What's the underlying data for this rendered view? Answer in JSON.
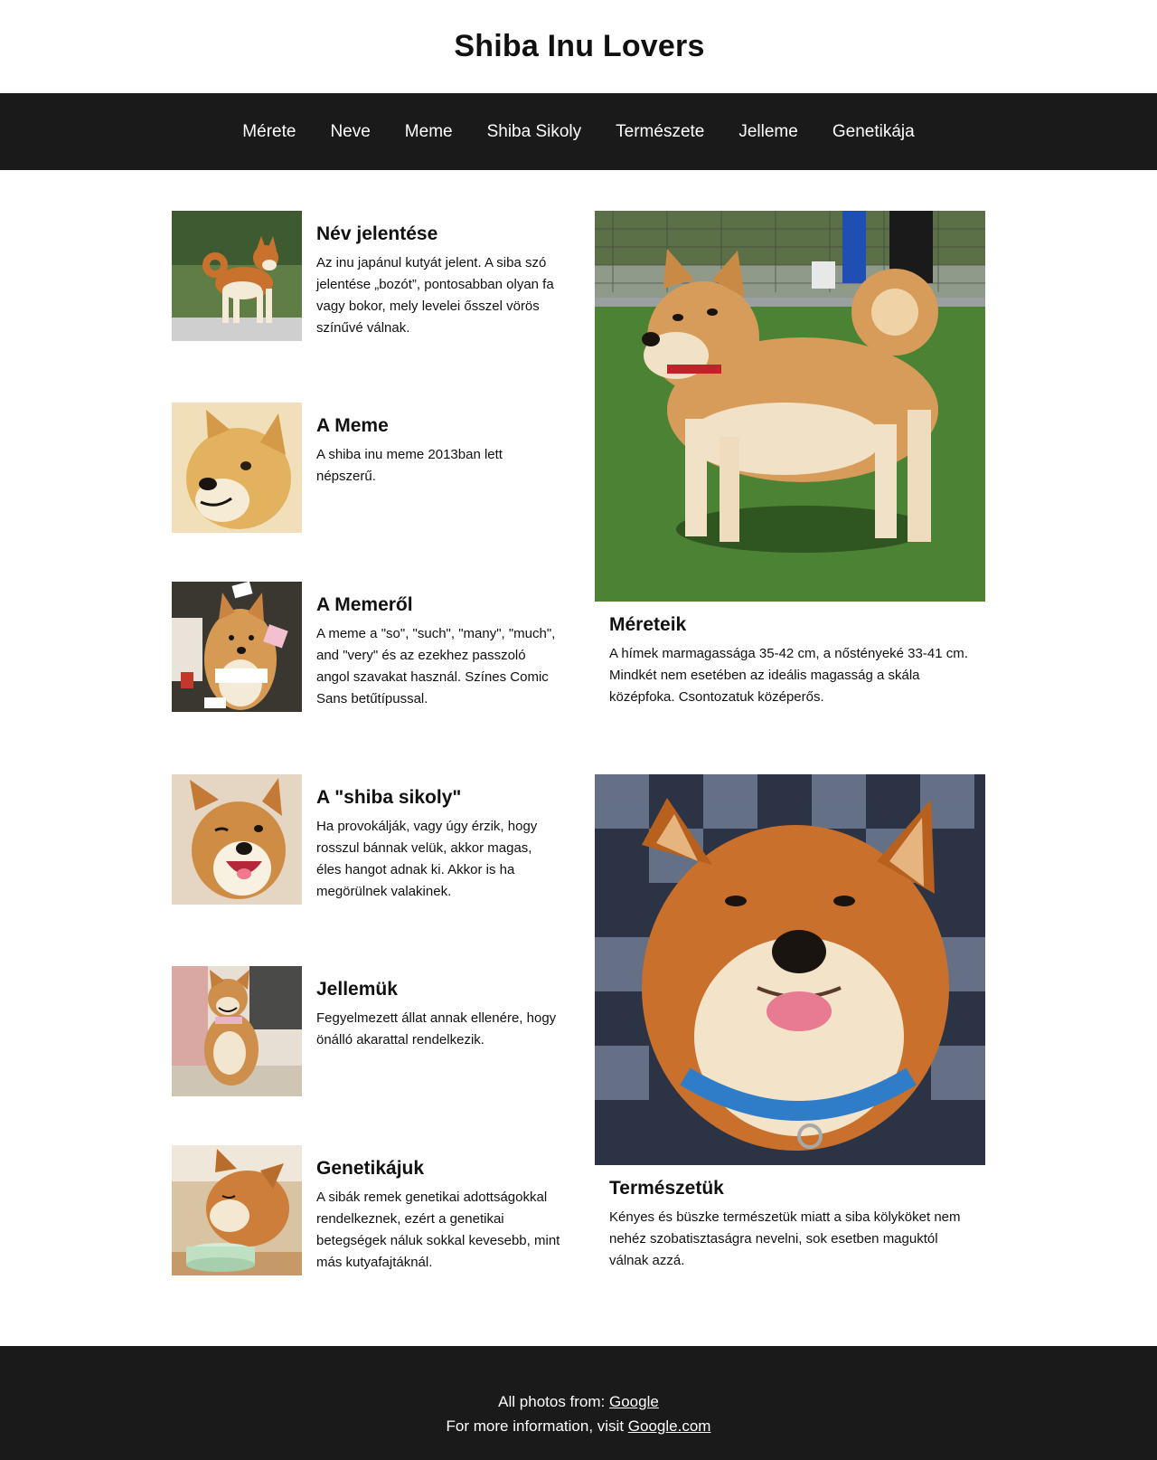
{
  "header": {
    "title": "Shiba Inu Lovers"
  },
  "nav": {
    "items": [
      {
        "label": "Mérete"
      },
      {
        "label": "Neve"
      },
      {
        "label": "Meme"
      },
      {
        "label": "Shiba Sikoly"
      },
      {
        "label": "Természete"
      },
      {
        "label": "Jelleme"
      },
      {
        "label": "Genetikája"
      }
    ]
  },
  "cards": {
    "name": {
      "title": "Név jelentése",
      "text": "Az inu japánul kutyát jelent. A siba szó jelentése „bozót”, pontosabban olyan fa vagy bokor, mely levelei ősszel vörös színűvé válnak."
    },
    "meme": {
      "title": "A Meme",
      "text": "A shiba inu meme 2013ban lett népszerű."
    },
    "about_meme": {
      "title": "A Memeről",
      "text": "A meme a \"so\", \"such\", \"many\", \"much\", and \"very\" és az ezekhez passzoló angol szavakat használ. Színes Comic Sans betűtípussal."
    },
    "scream": {
      "title": "A \"shiba sikoly\"",
      "text": "Ha provokálják, vagy úgy érzik, hogy rosszul bánnak velük, akkor magas, éles hangot adnak ki. Akkor is ha megörülnek valakinek."
    },
    "character": {
      "title": "Jellemük",
      "text": "Fegyelmezett állat annak ellenére, hogy önálló akarattal rendelkezik."
    },
    "genetics": {
      "title": "Genetikájuk",
      "text": "A sibák remek genetikai adottságokkal rendelkeznek, ezért a genetikai betegségek náluk sokkal kevesebb, mint más kutyafajtáknál."
    },
    "size": {
      "title": "Méreteik",
      "text": "A hímek marmagassága 35-42 cm, a nőstényeké 33-41 cm. Mindkét nem esetében az ideális magasság a skála középfoka. Csontozatuk középerős."
    },
    "nature": {
      "title": "Természetük",
      "text": "Kényes és büszke természetük miatt a siba kölyköket nem nehéz szobatisztaságra nevelni, sok esetben maguktól válnak azzá."
    }
  },
  "footer": {
    "photos_prefix": "All photos from: ",
    "photos_link": "Google",
    "info_prefix": "For more information, visit ",
    "info_link": "Google.com"
  }
}
